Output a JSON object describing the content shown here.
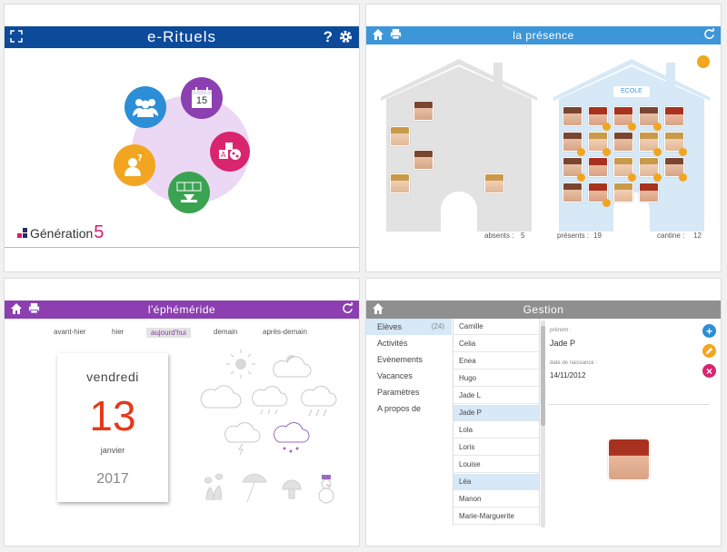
{
  "panel1": {
    "title": "e-Rituels",
    "help_label": "?",
    "calendar_day": "15",
    "logo": {
      "text": "Génération",
      "number": "5"
    },
    "colors": {
      "header": "#0c4a9a",
      "users": "#2b8ed6",
      "calendar": "#8b3fb0",
      "games": "#d9246e",
      "weather": "#3aa351",
      "help": "#f2a521"
    }
  },
  "panel2": {
    "title": "la présence",
    "school_label": "ECOLE",
    "absents_label": "absents :",
    "absents_value": "5",
    "presents_label": "présents :",
    "presents_value": "19",
    "cantine_label": "cantine :",
    "cantine_value": "12",
    "colors": {
      "header": "#3d96d8",
      "badge": "#f2a51f"
    }
  },
  "panel3": {
    "title": "l'éphéméride",
    "tabs": [
      "avant-hier",
      "hier",
      "aujourd'hui",
      "demain",
      "après-demain"
    ],
    "selected_tab": "aujourd'hui",
    "weekday": "vendredi",
    "day": "13",
    "month": "janvier",
    "year": "2017",
    "colors": {
      "header": "#8b3fb0",
      "day": "#e43a1a"
    }
  },
  "panel4": {
    "title": "Gestion",
    "menu": [
      {
        "label": "Elèves",
        "count": "(24)"
      },
      {
        "label": "Activités"
      },
      {
        "label": "Evènements"
      },
      {
        "label": "Vacances"
      },
      {
        "label": "Paramètres"
      },
      {
        "label": "A propos de"
      }
    ],
    "names": [
      "Camille",
      "Celia",
      "Enea",
      "Hugo",
      "Jade L",
      "Jade P",
      "Lola",
      "Loris",
      "Louise",
      "Léa",
      "Manon",
      "Marie-Marguerite"
    ],
    "selected_names": [
      "Jade P",
      "Léa"
    ],
    "firstname_label": "prénom :",
    "firstname_value": "Jade P",
    "birthdate_label": "date de naissance :",
    "birthdate_value": "14/11/2012",
    "colors": {
      "header": "#8f8f8f",
      "add": "#2b8ed6",
      "edit": "#f2a521",
      "delete": "#d9246e"
    }
  }
}
